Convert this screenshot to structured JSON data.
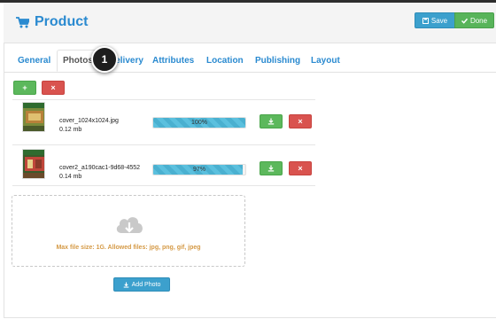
{
  "header": {
    "title": "Product",
    "save_label": "Save",
    "done_label": "Done",
    "cart_icon": "shopping-cart-icon"
  },
  "tabs": [
    {
      "label": "General"
    },
    {
      "label": "Photos",
      "active": true
    },
    {
      "label": "Delivery"
    },
    {
      "label": "Attributes"
    },
    {
      "label": "Location"
    },
    {
      "label": "Publishing"
    },
    {
      "label": "Layout"
    }
  ],
  "step_marker": "1",
  "toolbar": {
    "add_glyph": "+",
    "remove_glyph": "×"
  },
  "files": [
    {
      "name": "cover_1024x1024.jpg",
      "size": "0.12 mb",
      "progress_label": "100%",
      "progress": 100
    },
    {
      "name": "cover2_a190cac1-9d68-4552",
      "size": "0.14 mb",
      "progress_label": "97%",
      "progress": 97
    }
  ],
  "dropzone": {
    "text": "Max file size: 1G. Allowed files: jpg, png, gif, jpeg",
    "icon": "cloud-download-icon"
  },
  "add_photo_label": "Add Photo",
  "colors": {
    "accent": "#2a8ad0",
    "save": "#3ca0cd",
    "done": "#58b45a",
    "green": "#5cb85c",
    "red": "#d9534f",
    "warning_text": "#d59a46"
  }
}
